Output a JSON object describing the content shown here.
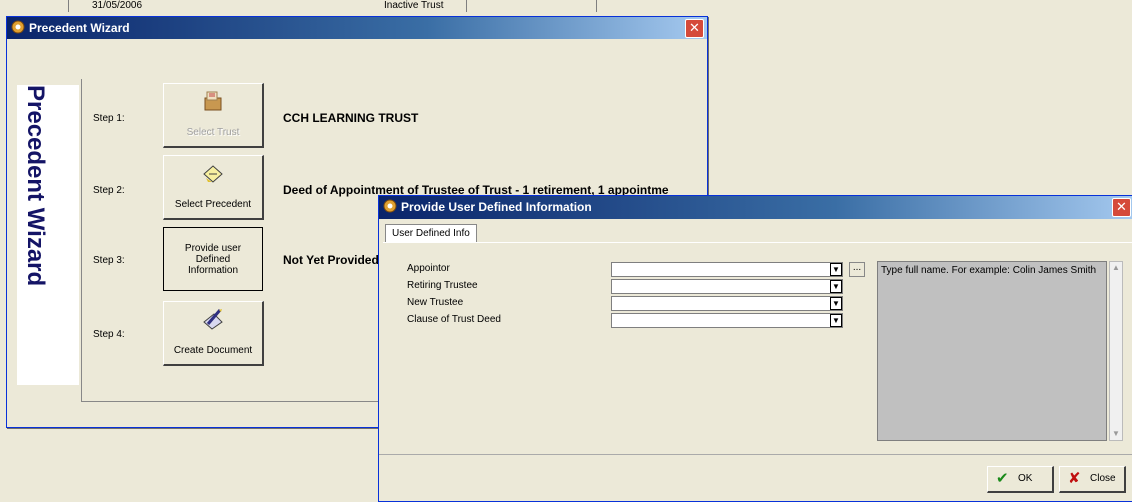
{
  "background": {
    "date_text": "31/05/2006",
    "status_text": "Inactive Trust"
  },
  "wizard": {
    "title": "Precedent Wizard",
    "vertical_title": "Precedent Wizard",
    "close_glyph": "✕",
    "steps": [
      {
        "label": "Step 1:",
        "button": "Select Trust",
        "value": "CCH LEARNING TRUST",
        "icon": "box-icon",
        "enabled": false
      },
      {
        "label": "Step 2:",
        "button": "Select Precedent",
        "value": "Deed of Appointment of Trustee of Trust - 1 retirement, 1 appointme",
        "icon": "document-icon",
        "enabled": true
      },
      {
        "label": "Step 3:",
        "button": "Provide user Defined Information",
        "value": "Not Yet Provided",
        "icon": "",
        "enabled": true
      },
      {
        "label": "Step 4:",
        "button": "Create Document",
        "value": "",
        "icon": "pen-paper-icon",
        "enabled": true
      }
    ]
  },
  "dialog": {
    "title": "Provide User Defined Information",
    "close_glyph": "✕",
    "tab": "User Defined Info",
    "fields": [
      {
        "label": "Appointor",
        "value": ""
      },
      {
        "label": "Retiring Trustee",
        "value": ""
      },
      {
        "label": "New Trustee",
        "value": ""
      },
      {
        "label": "Clause of Trust Deed",
        "value": ""
      }
    ],
    "ellipsis_label": "...",
    "help_text": "Type full name. For example: Colin James Smith",
    "ok_label": "OK",
    "close_label": "Close",
    "colors": {
      "title_start": "#0a246a",
      "title_end": "#a6caf0",
      "accent": "#141466"
    }
  }
}
